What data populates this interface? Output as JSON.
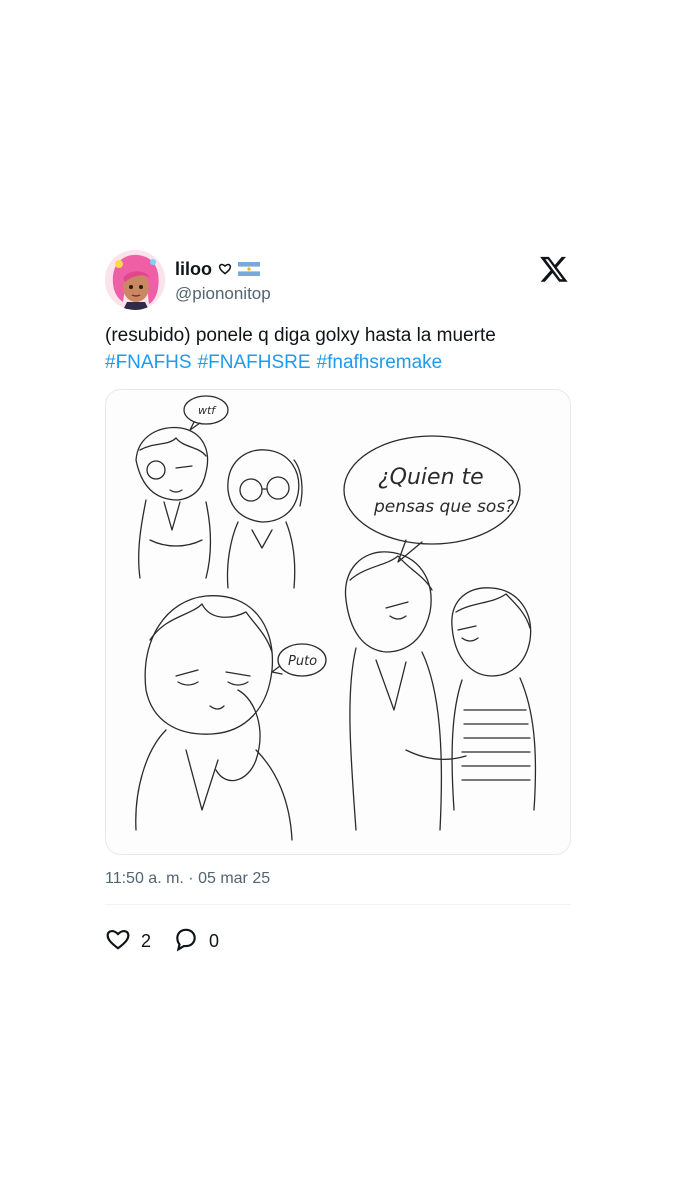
{
  "author": {
    "display_name": "liloo",
    "handle": "@piononitop",
    "heart_icon": "heart-outline-icon",
    "flag_icon": "argentina-flag-icon",
    "avatar_color": "#f06aa8"
  },
  "platform_icon": "x-logo-icon",
  "tweet": {
    "text": "(resubido) ponele q diga golxy hasta la muerte",
    "hashtags": [
      "#FNAFHS",
      "#FNAFHSRE",
      "#fnafhsremake"
    ],
    "hashtag_color": "#1d9bf0"
  },
  "media": {
    "speech_bubbles": [
      "wtf",
      "¿Quien te",
      "pensas que sos?",
      "Puto"
    ]
  },
  "timestamp": "11:50 a. m. · 05 mar 25",
  "actions": {
    "likes_count": "2",
    "replies_count": "0"
  }
}
